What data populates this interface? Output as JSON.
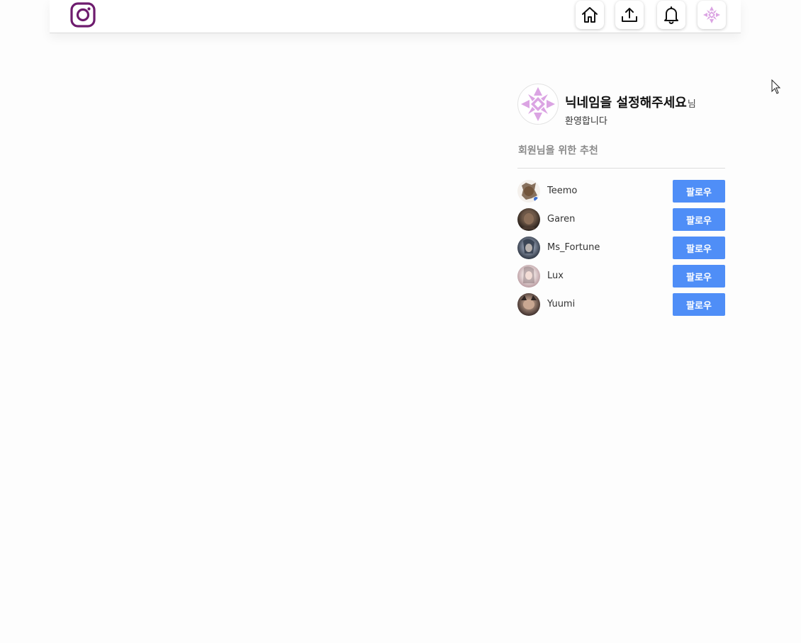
{
  "header": {
    "logo_icon": "instagram-logo-icon",
    "brand_color": "#7a1f7a",
    "nav": [
      {
        "name": "home",
        "icon": "home-icon"
      },
      {
        "name": "upload",
        "icon": "upload-icon"
      },
      {
        "name": "notifications",
        "icon": "bell-icon"
      },
      {
        "name": "profile",
        "icon": "avatar-icon"
      }
    ]
  },
  "profile": {
    "nickname": "닉네임을 설정해주세요",
    "suffix": "님",
    "welcome": "환영합니다"
  },
  "recommend": {
    "title": "회원님을 위한 추천",
    "follow_label": "팔로우",
    "follow_color": "#4f8ef7",
    "users": [
      {
        "name": "Teemo"
      },
      {
        "name": "Garen"
      },
      {
        "name": "Ms_Fortune"
      },
      {
        "name": "Lux"
      },
      {
        "name": "Yuumi"
      }
    ]
  }
}
